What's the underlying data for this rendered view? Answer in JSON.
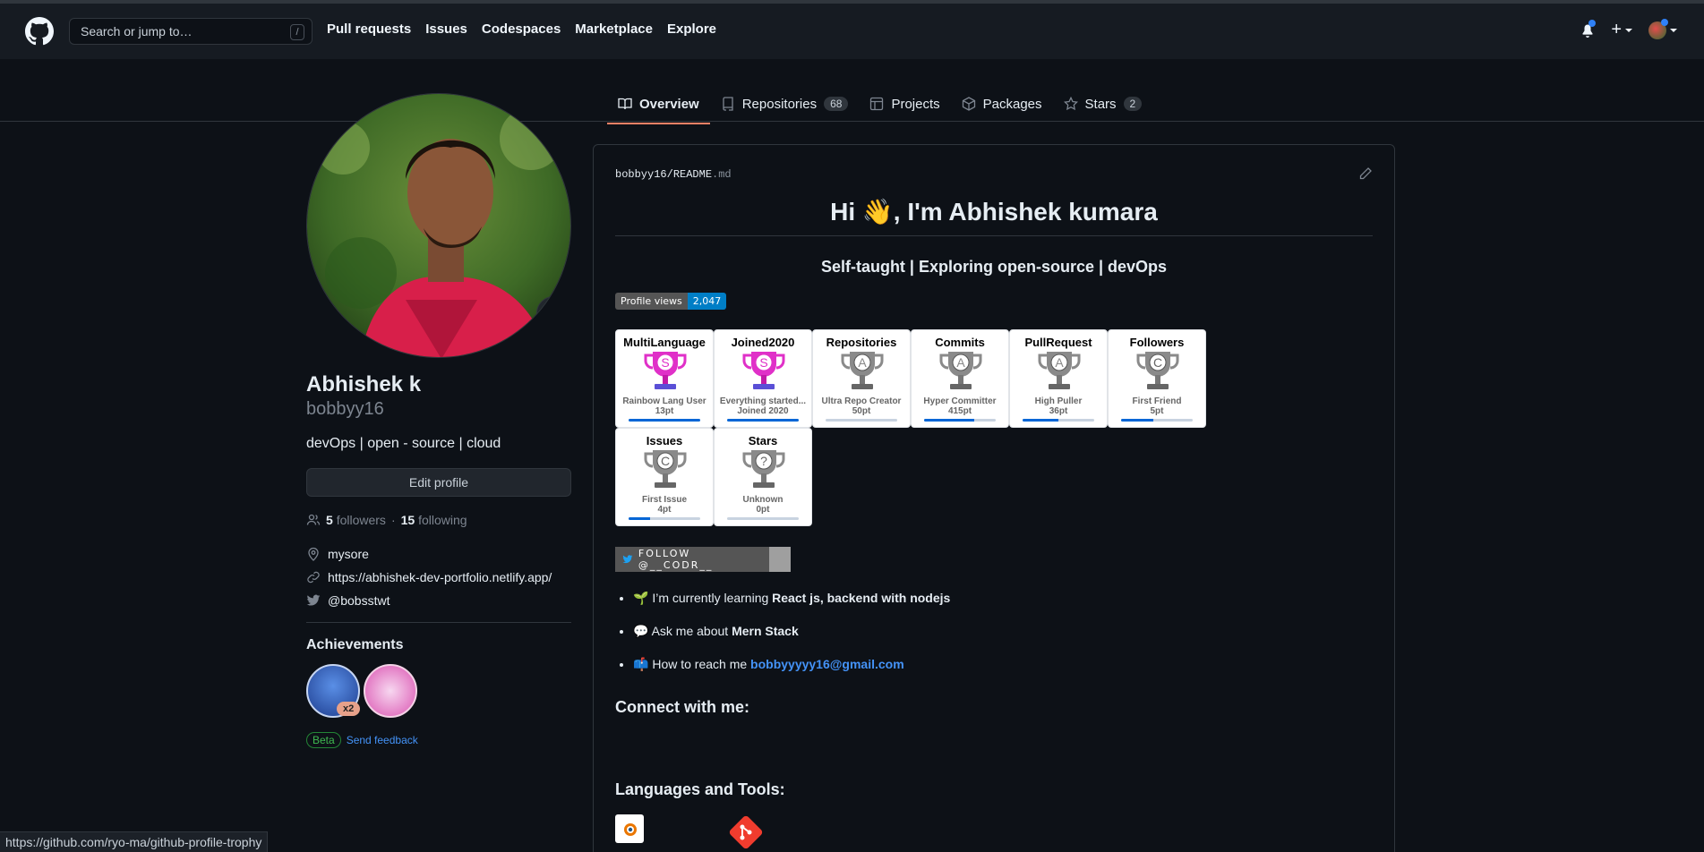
{
  "header": {
    "search_placeholder": "Search or jump to…",
    "slash_key": "/",
    "nav": [
      "Pull requests",
      "Issues",
      "Codespaces",
      "Marketplace",
      "Explore"
    ],
    "plus_label": "+"
  },
  "tabs": [
    {
      "label": "Overview",
      "count": ""
    },
    {
      "label": "Repositories",
      "count": "68"
    },
    {
      "label": "Projects",
      "count": ""
    },
    {
      "label": "Packages",
      "count": ""
    },
    {
      "label": "Stars",
      "count": "2"
    }
  ],
  "profile": {
    "name": "Abhishek k",
    "login": "bobbyy16",
    "bio": "devOps | open - source | cloud",
    "edit_label": "Edit profile",
    "followers_count": "5",
    "followers_label": "followers",
    "dot": "·",
    "following_count": "15",
    "following_label": "following",
    "location": "mysore",
    "website": "https://abhishek-dev-portfolio.netlify.app/",
    "twitter": "@bobsstwt",
    "achievements_title": "Achievements",
    "badge_multiplier": "x2",
    "beta_label": "Beta",
    "feedback_label": "Send feedback"
  },
  "readme": {
    "owner": "bobbyy16",
    "path_sep": "/",
    "file": "README",
    "ext": ".md",
    "title": "Hi 👋, I'm Abhishek kumara",
    "subtitle": "Self-taught | Exploring open-source | devOps",
    "views_label": "Profile views",
    "views_value": "2,047",
    "trophies": [
      {
        "title": "MultiLanguage",
        "rank": "S",
        "desc": "Rainbow Lang User",
        "pts": "13pt",
        "progress": 1.0
      },
      {
        "title": "Joined2020",
        "rank": "S",
        "desc": "Everything started...",
        "pts": "Joined 2020",
        "progress": 1.0
      },
      {
        "title": "Repositories",
        "rank": "A",
        "desc": "Ultra Repo Creator",
        "pts": "50pt",
        "progress": 0.0
      },
      {
        "title": "Commits",
        "rank": "A",
        "desc": "Hyper Committer",
        "pts": "415pt",
        "progress": 0.7
      },
      {
        "title": "PullRequest",
        "rank": "A",
        "desc": "High Puller",
        "pts": "36pt",
        "progress": 0.5
      },
      {
        "title": "Followers",
        "rank": "C",
        "desc": "First Friend",
        "pts": "5pt",
        "progress": 0.45
      },
      {
        "title": "Issues",
        "rank": "C",
        "desc": "First Issue",
        "pts": "4pt",
        "progress": 0.3
      },
      {
        "title": "Stars",
        "rank": "?",
        "desc": "Unknown",
        "pts": "0pt",
        "progress": 0.0
      }
    ],
    "twitter_badge": "FOLLOW @__CODR__",
    "list": [
      {
        "emoji": "🌱",
        "text": "I’m currently learning ",
        "bold": "React js, backend with nodejs"
      },
      {
        "emoji": "💬",
        "text": "Ask me about ",
        "bold": "Mern Stack"
      },
      {
        "emoji": "📫",
        "text": "How to reach me ",
        "bold": "bobbyyyyy16@gmail.com"
      }
    ],
    "connect_title": "Connect with me:",
    "tools_title": "Languages and Tools:"
  },
  "status_url": "https://github.com/ryo-ma/github-profile-trophy",
  "colors": {
    "accent": "#2f81f7",
    "tab_underline": "#f78166",
    "link": "#4493f8"
  }
}
